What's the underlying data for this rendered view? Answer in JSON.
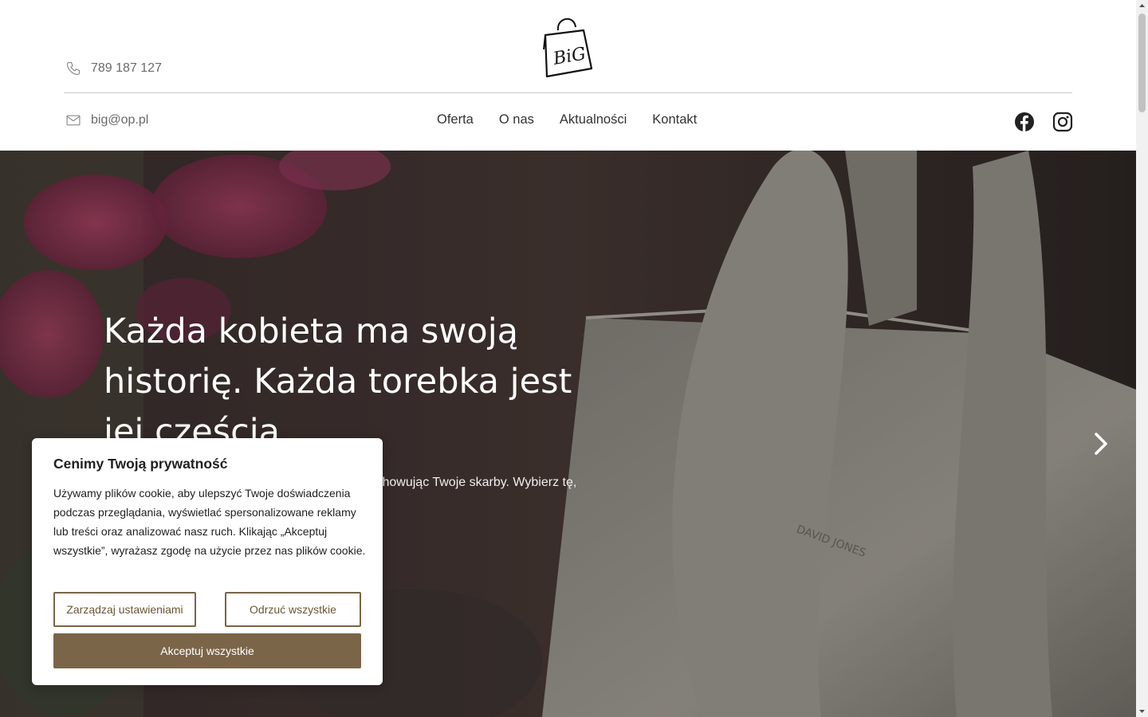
{
  "header": {
    "phone": "789 187 127",
    "email": "big@op.pl",
    "logo_text": "BiG",
    "nav": [
      "Oferta",
      "O nas",
      "Aktualności",
      "Kontakt"
    ],
    "social": [
      "facebook-icon",
      "instagram-icon"
    ]
  },
  "hero": {
    "title": "Każda kobieta ma swoją historię. Każda torebka jest jej częścią.",
    "text": "Nasze torebki towarzyszą Ci każdego dnia, przechowując Twoje skarby. Wybierz tę, która najlepiej odzwierciedla Twój styl.",
    "next_icon": "chevron-right-icon"
  },
  "cookie": {
    "title": "Cenimy Twoją prywatność",
    "text": "Używamy plików cookie, aby ulepszyć Twoje doświadczenia podczas przeglądania, wyświetlać spersonalizowane reklamy lub treści oraz analizować nasz ruch. Klikając „Akceptuj wszystkie”, wyrażasz zgodę na użycie przez nas plików cookie.",
    "manage_label": "Zarządzaj ustawieniami",
    "reject_label": "Odrzuć wszystkie",
    "accept_label": "Akceptuj wszystkie"
  },
  "colors": {
    "accent": "#7b6549",
    "hero_overlay": "#3a2f2d"
  }
}
